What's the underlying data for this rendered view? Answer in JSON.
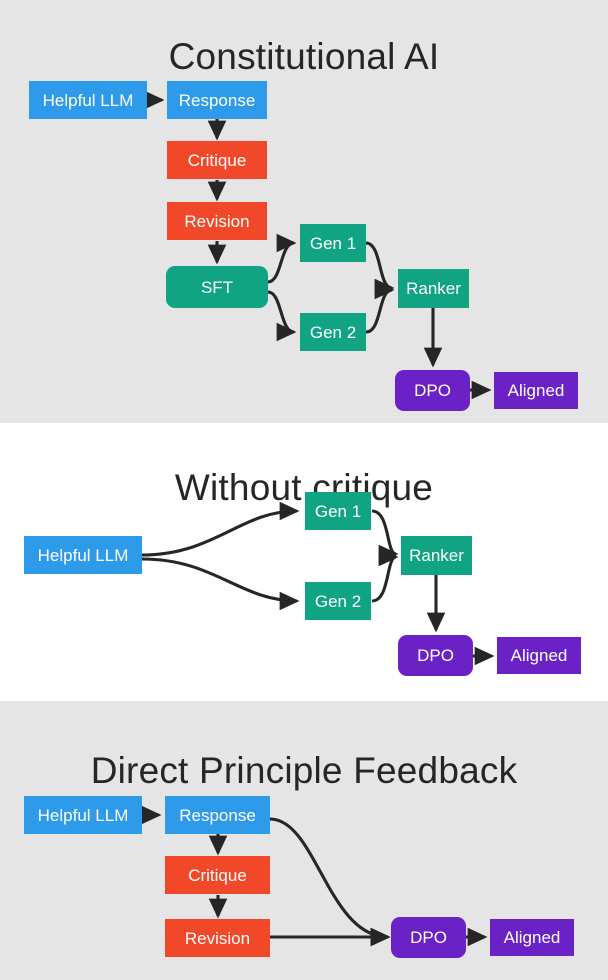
{
  "figure": {
    "background": "#ffffff",
    "panel_shaded_color": "#e5e5e5",
    "colors": {
      "blue": "#2e9bea",
      "red": "#f2482a",
      "green": "#10a483",
      "purple": "#6a21c6",
      "arrow": "#262626",
      "title_text": "#262626",
      "node_text": "#ffffff"
    }
  },
  "panels": [
    {
      "id": "constitutional-ai",
      "title": "Constitutional AI",
      "background": "shaded",
      "nodes": [
        {
          "id": "cai-helpful-llm",
          "label": "Helpful LLM",
          "color": "blue",
          "shape": "rect"
        },
        {
          "id": "cai-response",
          "label": "Response",
          "color": "blue",
          "shape": "rect"
        },
        {
          "id": "cai-critique",
          "label": "Critique",
          "color": "red",
          "shape": "rect"
        },
        {
          "id": "cai-revision",
          "label": "Revision",
          "color": "red",
          "shape": "rect"
        },
        {
          "id": "cai-sft",
          "label": "SFT",
          "color": "green",
          "shape": "rounded"
        },
        {
          "id": "cai-gen1",
          "label": "Gen 1",
          "color": "green",
          "shape": "rect"
        },
        {
          "id": "cai-gen2",
          "label": "Gen 2",
          "color": "green",
          "shape": "rect"
        },
        {
          "id": "cai-ranker",
          "label": "Ranker",
          "color": "green",
          "shape": "rect"
        },
        {
          "id": "cai-dpo",
          "label": "DPO",
          "color": "purple",
          "shape": "rounded"
        },
        {
          "id": "cai-aligned",
          "label": "Aligned",
          "color": "purple",
          "shape": "rect"
        }
      ],
      "edges": [
        {
          "from": "cai-helpful-llm",
          "to": "cai-response"
        },
        {
          "from": "cai-response",
          "to": "cai-critique"
        },
        {
          "from": "cai-critique",
          "to": "cai-revision"
        },
        {
          "from": "cai-revision",
          "to": "cai-sft"
        },
        {
          "from": "cai-sft",
          "to": "cai-gen1"
        },
        {
          "from": "cai-sft",
          "to": "cai-gen2"
        },
        {
          "from": "cai-gen1",
          "to": "cai-ranker"
        },
        {
          "from": "cai-gen2",
          "to": "cai-ranker"
        },
        {
          "from": "cai-ranker",
          "to": "cai-dpo"
        },
        {
          "from": "cai-dpo",
          "to": "cai-aligned"
        }
      ]
    },
    {
      "id": "without-critique",
      "title": "Without critique",
      "background": "plain",
      "nodes": [
        {
          "id": "wc-helpful-llm",
          "label": "Helpful LLM",
          "color": "blue",
          "shape": "rect"
        },
        {
          "id": "wc-gen1",
          "label": "Gen 1",
          "color": "green",
          "shape": "rect"
        },
        {
          "id": "wc-gen2",
          "label": "Gen 2",
          "color": "green",
          "shape": "rect"
        },
        {
          "id": "wc-ranker",
          "label": "Ranker",
          "color": "green",
          "shape": "rect"
        },
        {
          "id": "wc-dpo",
          "label": "DPO",
          "color": "purple",
          "shape": "rounded"
        },
        {
          "id": "wc-aligned",
          "label": "Aligned",
          "color": "purple",
          "shape": "rect"
        }
      ],
      "edges": [
        {
          "from": "wc-helpful-llm",
          "to": "wc-gen1"
        },
        {
          "from": "wc-helpful-llm",
          "to": "wc-gen2"
        },
        {
          "from": "wc-gen1",
          "to": "wc-ranker"
        },
        {
          "from": "wc-gen2",
          "to": "wc-ranker"
        },
        {
          "from": "wc-ranker",
          "to": "wc-dpo"
        },
        {
          "from": "wc-dpo",
          "to": "wc-aligned"
        }
      ]
    },
    {
      "id": "direct-principle-feedback",
      "title": "Direct Principle Feedback",
      "background": "shaded",
      "nodes": [
        {
          "id": "dpf-helpful-llm",
          "label": "Helpful LLM",
          "color": "blue",
          "shape": "rect"
        },
        {
          "id": "dpf-response",
          "label": "Response",
          "color": "blue",
          "shape": "rect"
        },
        {
          "id": "dpf-critique",
          "label": "Critique",
          "color": "red",
          "shape": "rect"
        },
        {
          "id": "dpf-revision",
          "label": "Revision",
          "color": "red",
          "shape": "rect"
        },
        {
          "id": "dpf-dpo",
          "label": "DPO",
          "color": "purple",
          "shape": "rounded"
        },
        {
          "id": "dpf-aligned",
          "label": "Aligned",
          "color": "purple",
          "shape": "rect"
        }
      ],
      "edges": [
        {
          "from": "dpf-helpful-llm",
          "to": "dpf-response"
        },
        {
          "from": "dpf-response",
          "to": "dpf-critique"
        },
        {
          "from": "dpf-critique",
          "to": "dpf-revision"
        },
        {
          "from": "dpf-response",
          "to": "dpf-dpo"
        },
        {
          "from": "dpf-revision",
          "to": "dpf-dpo"
        },
        {
          "from": "dpf-dpo",
          "to": "dpf-aligned"
        }
      ]
    }
  ]
}
